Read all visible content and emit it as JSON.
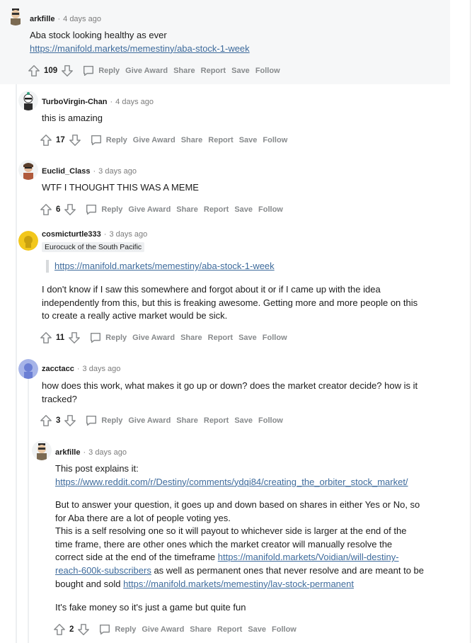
{
  "comments": [
    {
      "author": "arkfille",
      "time": "4 days ago",
      "lines": [
        "Aba stock looking healthy as ever"
      ],
      "link": "https://manifold.markets/memestiny/aba-stock-1-week",
      "score": "109"
    },
    {
      "author": "TurboVirgin-Chan",
      "time": "4 days ago",
      "lines": [
        "this is amazing"
      ],
      "score": "17"
    },
    {
      "author": "Euclid_Class",
      "time": "3 days ago",
      "lines": [
        "WTF I THOUGHT THIS WAS A MEME"
      ],
      "score": "6"
    },
    {
      "author": "cosmicturtle333",
      "time": "3 days ago",
      "flair": "Eurocuck of the South Pacific",
      "quote_link": "https://manifold.markets/memestiny/aba-stock-1-week",
      "lines": [
        "I don't know if I saw this somewhere and forgot about it or if I came up with the idea",
        "independently from this, but this is freaking awesome. Getting more and more people on this",
        "to create a really active market would be sick."
      ],
      "score": "11"
    },
    {
      "author": "zacctacc",
      "time": "3 days ago",
      "lines": [
        "how does this work, what makes it go up or down? does the market creator decide? how is it",
        "tracked?"
      ],
      "score": "3"
    },
    {
      "author": "arkfille",
      "time": "3 days ago",
      "intro": "This post explains it:",
      "link1": "https://www.reddit.com/r/Destiny/comments/ydqi84/creating_the_orbiter_stock_market/",
      "p2_lines": [
        "But to answer your question, it goes up and down based on shares in either Yes or No, so",
        "for Aba there are a lot of people voting yes.",
        "This is a self resolving one so it will payout to whichever side is larger at the end of the",
        "time frame, there are other ones which the market creator will manually resolve the"
      ],
      "p2_l5_text": "correct side at the end of the timeframe ",
      "link2_part1": "https://manifold.markets/Voidian/will-destiny-",
      "link2_part2": "reach-600k-subscribers",
      "p2_l6_text": " as well as permanent ones that never resolve and are meant to be",
      "p2_l7_text": "bought and sold ",
      "link3": "https://manifold.markets/memestiny/lav-stock-permanent",
      "p3": "It's fake money so it's just a game but quite fun",
      "score": "2"
    }
  ],
  "actions": {
    "reply": "Reply",
    "give_award": "Give Award",
    "share": "Share",
    "report": "Report",
    "save": "Save",
    "follow": "Follow"
  },
  "separator": "·"
}
